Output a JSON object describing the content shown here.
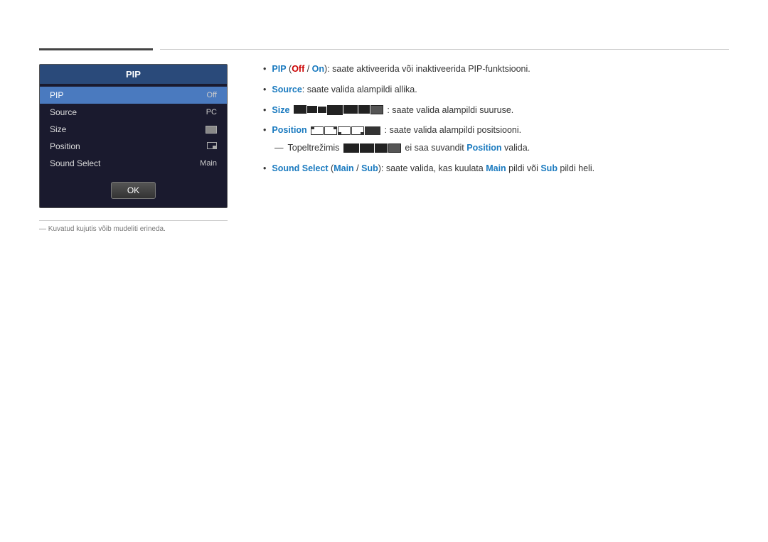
{
  "topLines": {
    "show": true
  },
  "pipPanel": {
    "title": "PIP",
    "items": [
      {
        "label": "PIP",
        "value": "Off",
        "state": "highlighted"
      },
      {
        "label": "Source",
        "value": "PC",
        "state": "normal"
      },
      {
        "label": "Size",
        "value": "",
        "state": "normal",
        "hasIcon": "size"
      },
      {
        "label": "Position",
        "value": "",
        "state": "normal",
        "hasIcon": "position"
      },
      {
        "label": "Sound Select",
        "value": "Main",
        "state": "normal"
      }
    ],
    "okButton": "OK"
  },
  "bottomNote": "― Kuvatud kujutis võib mudeliti erineda.",
  "bulletPoints": [
    {
      "id": "pip-bullet",
      "prefix": "PIP (",
      "offText": "Off",
      "slash": " / ",
      "onText": "On",
      "suffix": "): saate aktiveerida või inaktiveerida PIP-funktsiooni."
    },
    {
      "id": "source-bullet",
      "boldLabel": "Source",
      "text": ": saate valida alampildi allika."
    },
    {
      "id": "size-bullet",
      "boldLabel": "Size",
      "text": ": saate valida alampildi suuruse.",
      "hasSizeIcons": true
    },
    {
      "id": "position-bullet",
      "boldLabel": "Position",
      "text": ": saate valida alampildi positsiooni.",
      "hasPosIcons": true
    },
    {
      "id": "sound-bullet",
      "boldLabel": "Sound Select",
      "openParen": " (",
      "mainText": "Main",
      "slash2": " / ",
      "subText": "Sub",
      "closeParen": "): saate valida, kas kuulata ",
      "mainText2": "Main",
      "midText": " pildi või ",
      "subText2": "Sub",
      "endText": " pildi heli."
    }
  ],
  "indentedNote": {
    "prefix": "Topeltrežimis",
    "middle": " ei saa suvandit ",
    "boldText": "Position",
    "suffix": " valida."
  }
}
